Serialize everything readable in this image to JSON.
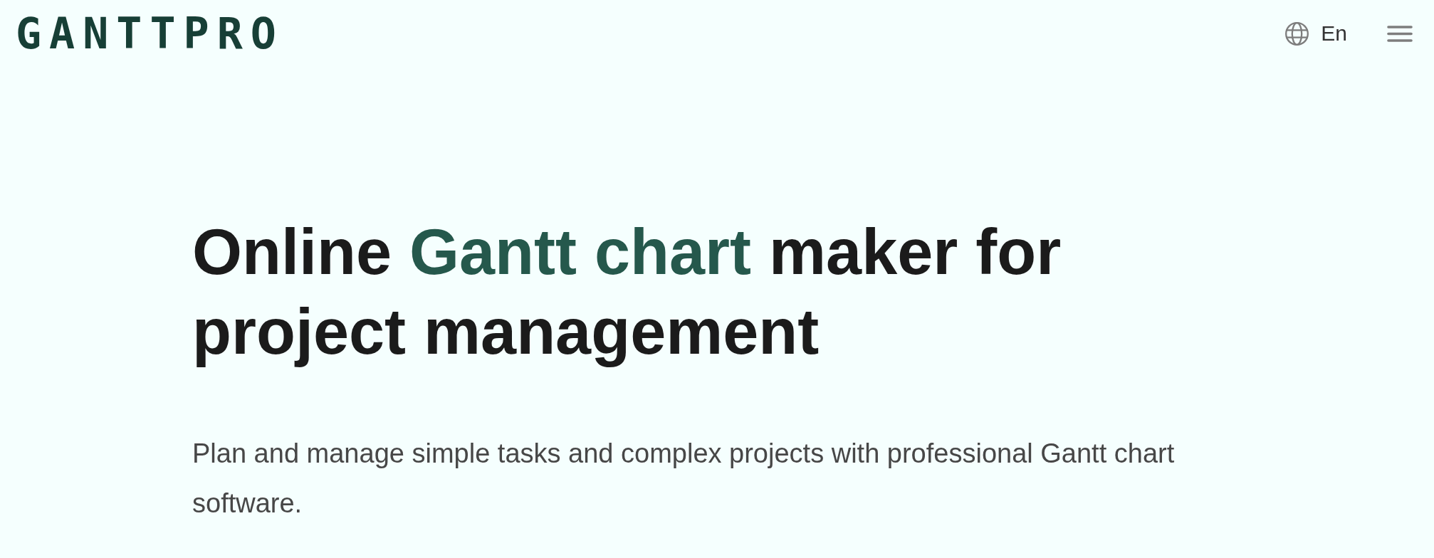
{
  "header": {
    "logo": "GANTTPRO",
    "language": {
      "label": "En"
    }
  },
  "hero": {
    "headline": [
      {
        "text": "Online ",
        "highlight": false
      },
      {
        "text": "Gantt chart",
        "highlight": true
      },
      {
        "text": " maker for project management",
        "highlight": false
      }
    ],
    "subtitle": "Plan and manage simple tasks and complex projects with professional Gantt chart software."
  }
}
